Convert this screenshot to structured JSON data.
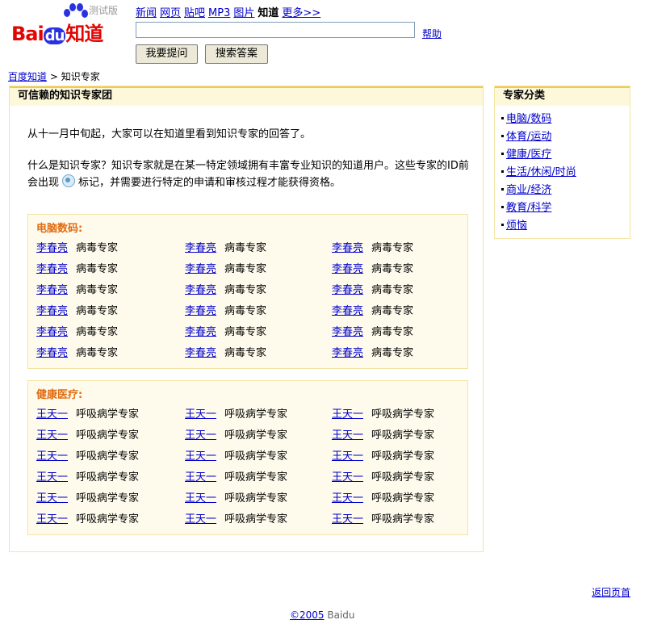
{
  "header": {
    "logo_letters": "Bai",
    "logo_du": "du",
    "logo_zhidao": "知道",
    "logo_badge": "测试版",
    "nav": [
      {
        "label": "新闻",
        "current": false
      },
      {
        "label": "网页",
        "current": false
      },
      {
        "label": "贴吧",
        "current": false
      },
      {
        "label": "MP3",
        "current": false
      },
      {
        "label": "图片",
        "current": false
      },
      {
        "label": "知道",
        "current": true
      },
      {
        "label": "更多>>",
        "current": false
      }
    ],
    "search_value": "",
    "help_label": "帮助",
    "ask_button": "我要提问",
    "search_button": "搜索答案"
  },
  "breadcrumb": {
    "home": "百度知道",
    "separator": ">",
    "current": "知识专家"
  },
  "main": {
    "title": "可信赖的知识专家团",
    "intro1": "从十一月中旬起，大家可以在知道里看到知识专家的回答了。",
    "intro2_part1": "什么是知识专家？知识专家就是在某一特定领域拥有丰富专业知识的知道用户。这些专家的ID前会出现",
    "intro2_part2": "标记，并需要进行特定的申请和审核过程才能获得资格。",
    "categories": [
      {
        "title": "电脑数码:",
        "rows": [
          [
            {
              "name": "李春亮",
              "role": "病毒专家"
            },
            {
              "name": "李春亮",
              "role": "病毒专家"
            },
            {
              "name": "李春亮",
              "role": "病毒专家"
            }
          ],
          [
            {
              "name": "李春亮",
              "role": "病毒专家"
            },
            {
              "name": "李春亮",
              "role": "病毒专家"
            },
            {
              "name": "李春亮",
              "role": "病毒专家"
            }
          ],
          [
            {
              "name": "李春亮",
              "role": "病毒专家"
            },
            {
              "name": "李春亮",
              "role": "病毒专家"
            },
            {
              "name": "李春亮",
              "role": "病毒专家"
            }
          ],
          [
            {
              "name": "李春亮",
              "role": "病毒专家"
            },
            {
              "name": "李春亮",
              "role": "病毒专家"
            },
            {
              "name": "李春亮",
              "role": "病毒专家"
            }
          ],
          [
            {
              "name": "李春亮",
              "role": "病毒专家"
            },
            {
              "name": "李春亮",
              "role": "病毒专家"
            },
            {
              "name": "李春亮",
              "role": "病毒专家"
            }
          ],
          [
            {
              "name": "李春亮",
              "role": "病毒专家"
            },
            {
              "name": "李春亮",
              "role": "病毒专家"
            },
            {
              "name": "李春亮",
              "role": "病毒专家"
            }
          ]
        ]
      },
      {
        "title": "健康医疗:",
        "rows": [
          [
            {
              "name": "王天一",
              "role": "呼吸病学专家"
            },
            {
              "name": "王天一",
              "role": "呼吸病学专家"
            },
            {
              "name": "王天一",
              "role": "呼吸病学专家"
            }
          ],
          [
            {
              "name": "王天一",
              "role": "呼吸病学专家"
            },
            {
              "name": "王天一",
              "role": "呼吸病学专家"
            },
            {
              "name": "王天一",
              "role": "呼吸病学专家"
            }
          ],
          [
            {
              "name": "王天一",
              "role": "呼吸病学专家"
            },
            {
              "name": "王天一",
              "role": "呼吸病学专家"
            },
            {
              "name": "王天一",
              "role": "呼吸病学专家"
            }
          ],
          [
            {
              "name": "王天一",
              "role": "呼吸病学专家"
            },
            {
              "name": "王天一",
              "role": "呼吸病学专家"
            },
            {
              "name": "王天一",
              "role": "呼吸病学专家"
            }
          ],
          [
            {
              "name": "王天一",
              "role": "呼吸病学专家"
            },
            {
              "name": "王天一",
              "role": "呼吸病学专家"
            },
            {
              "name": "王天一",
              "role": "呼吸病学专家"
            }
          ],
          [
            {
              "name": "王天一",
              "role": "呼吸病学专家"
            },
            {
              "name": "王天一",
              "role": "呼吸病学专家"
            },
            {
              "name": "王天一",
              "role": "呼吸病学专家"
            }
          ]
        ]
      }
    ]
  },
  "sidebar": {
    "title": "专家分类",
    "items": [
      "电脑/数码",
      "体育/运动",
      "健康/医疗",
      "生活/休闲/时尚",
      "商业/经济",
      "教育/科学",
      "烦恼"
    ]
  },
  "footer": {
    "back_top": "返回页首",
    "copyright_link": "©2005",
    "copyright_text": " Baidu"
  },
  "colors": {
    "link": "#0000cc",
    "category_title": "#e26b10",
    "box_header_bg": "#fdf8da",
    "box_border": "#f2e5a3",
    "category_bg": "#fffbec",
    "logo_red": "#e10602",
    "logo_blue": "#2932e1"
  },
  "icons": {
    "logo_paw": "paw-icon",
    "expert_badge": "expert-badge-icon",
    "list_bullet": "bullet-icon"
  }
}
